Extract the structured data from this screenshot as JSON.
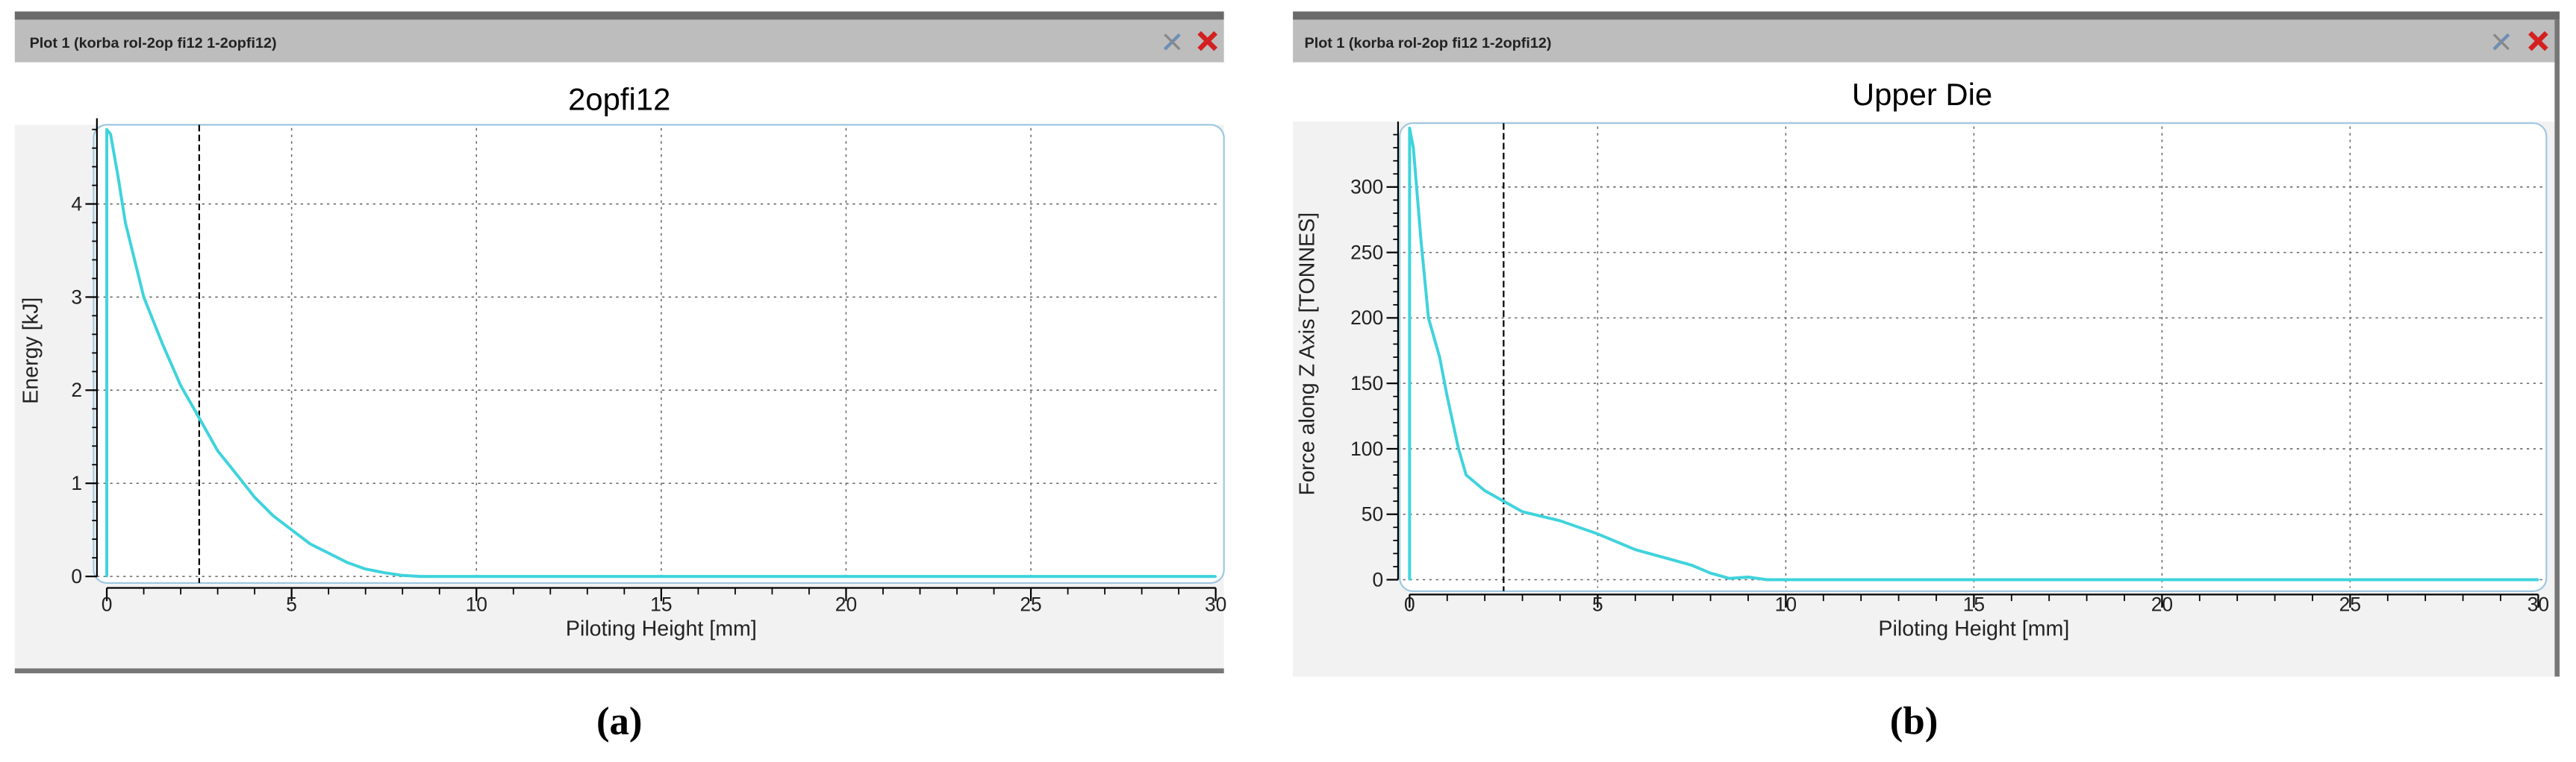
{
  "panels": [
    {
      "window_title": "Plot 1 (korba rol-2op fi12 1-2opfi12)",
      "caption": "(a)",
      "caption_bold": "a",
      "icons": [
        "wrench-icon",
        "close-icon"
      ]
    },
    {
      "window_title": "Plot 1 (korba rol-2op fi12 1-2opfi12)",
      "caption": "(b)",
      "caption_bold": "b",
      "icons": [
        "wrench-icon",
        "close-icon"
      ]
    }
  ],
  "colors": {
    "series": "#3fd3dc",
    "titlebar": "#bdbdbd",
    "frame": "#9ec7e0",
    "close": "#d42020"
  },
  "chart_data": [
    {
      "type": "line",
      "title": "2opfi12",
      "xlabel": "Piloting Height [mm]",
      "ylabel": "Energy [kJ]",
      "xlim": [
        0,
        30
      ],
      "ylim": [
        0,
        4.85
      ],
      "xticks": [
        0,
        5,
        10,
        15,
        20,
        25,
        30
      ],
      "xtick_labels": [
        "0",
        "5",
        "10",
        "15",
        "20",
        "25",
        "30"
      ],
      "yticks": [
        0,
        1,
        2,
        3,
        4
      ],
      "ytick_labels": [
        "0",
        "1",
        "2",
        "3",
        "4"
      ],
      "x_minor_step": 1,
      "y_minor_step": 0.2,
      "grid": true,
      "marker_line_x": 2.5,
      "series": [
        {
          "name": "Energy",
          "x": [
            0,
            0,
            0.1,
            0.3,
            0.5,
            1,
            1.5,
            2,
            2.5,
            3,
            3.5,
            4,
            4.5,
            5,
            5.5,
            6,
            6.5,
            7,
            7.5,
            8,
            8.5,
            30
          ],
          "y": [
            0,
            4.8,
            4.75,
            4.3,
            3.8,
            3.0,
            2.5,
            2.05,
            1.7,
            1.35,
            1.1,
            0.85,
            0.65,
            0.5,
            0.35,
            0.25,
            0.15,
            0.08,
            0.04,
            0.01,
            0,
            0
          ]
        }
      ]
    },
    {
      "type": "line",
      "title": "Upper Die",
      "xlabel": "Piloting Height [mm]",
      "ylabel": "Force along Z Axis [TONNES]",
      "xlim": [
        0,
        30
      ],
      "ylim": [
        0,
        345
      ],
      "xticks": [
        0,
        5,
        10,
        15,
        20,
        25,
        30
      ],
      "xtick_labels": [
        "0",
        "5",
        "10",
        "15",
        "20",
        "25",
        "30"
      ],
      "yticks": [
        0,
        50,
        100,
        150,
        200,
        250,
        300
      ],
      "ytick_labels": [
        "0",
        "50",
        "100",
        "150",
        "200",
        "250",
        "300"
      ],
      "x_minor_step": 1,
      "y_minor_step": 10,
      "grid": true,
      "marker_line_x": 2.5,
      "series": [
        {
          "name": "Force",
          "x": [
            0,
            0,
            0.1,
            0.3,
            0.5,
            0.8,
            1.0,
            1.3,
            1.5,
            2,
            2.5,
            3,
            4,
            5,
            6,
            7,
            7.5,
            8,
            8.5,
            9,
            9.5,
            30
          ],
          "y": [
            0,
            345,
            330,
            260,
            200,
            170,
            140,
            100,
            80,
            68,
            60,
            52,
            45,
            35,
            23,
            15,
            11,
            5,
            1,
            2,
            0,
            0
          ]
        }
      ]
    }
  ]
}
